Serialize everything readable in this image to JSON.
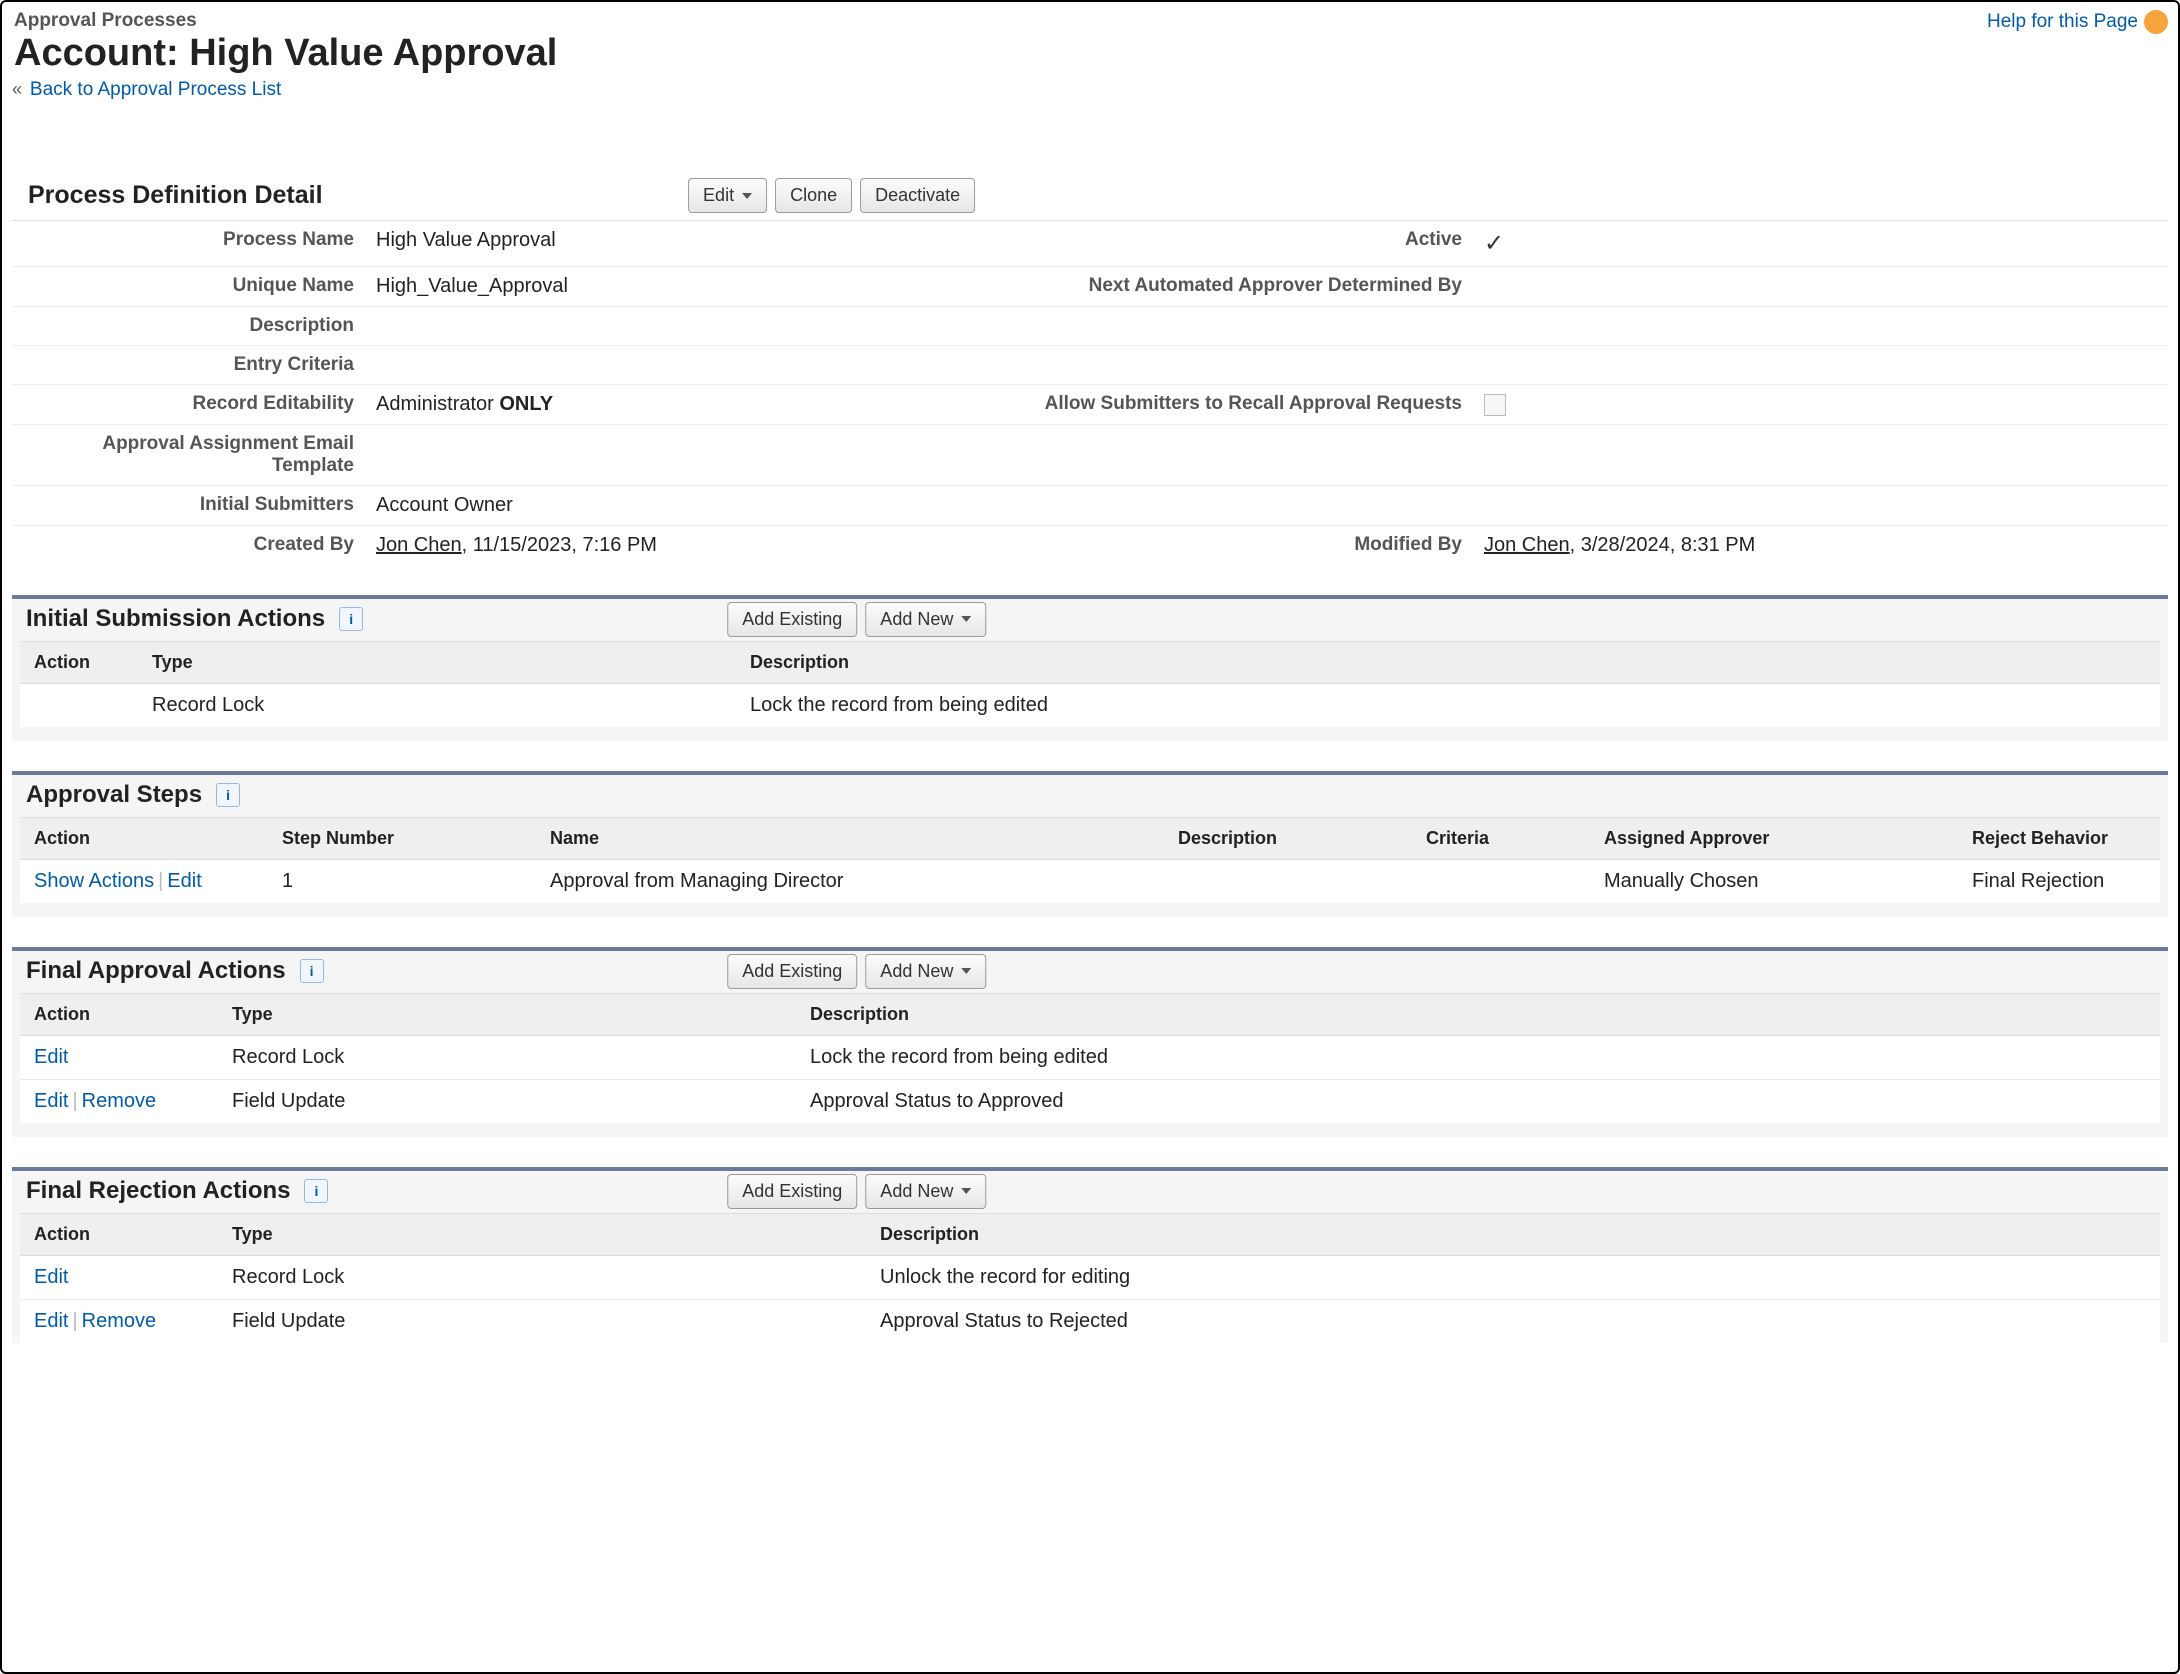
{
  "header": {
    "breadcrumb": "Approval Processes",
    "title": "Account: High Value Approval",
    "back_link": "Back to Approval Process List",
    "help_link": "Help for this Page"
  },
  "definition": {
    "section_title": "Process Definition Detail",
    "buttons": {
      "edit": "Edit",
      "clone": "Clone",
      "deactivate": "Deactivate"
    },
    "labels": {
      "process_name": "Process Name",
      "unique_name": "Unique Name",
      "description": "Description",
      "entry_criteria": "Entry Criteria",
      "record_editability": "Record Editability",
      "approval_assignment_email": "Approval Assignment Email Template",
      "initial_submitters": "Initial Submitters",
      "created_by": "Created By",
      "active": "Active",
      "next_auto": "Next Automated Approver Determined By",
      "allow_recall": "Allow Submitters to Recall Approval Requests",
      "modified_by": "Modified By"
    },
    "values": {
      "process_name": "High Value Approval",
      "unique_name": "High_Value_Approval",
      "description": "",
      "entry_criteria": "",
      "record_editability_prefix": "Administrator ",
      "record_editability_bold": "ONLY",
      "approval_assignment_email": "",
      "initial_submitters": "Account Owner",
      "created_by_name": "Jon Chen",
      "created_by_rest": ", 11/15/2023, 7:16 PM",
      "active": true,
      "next_auto": "",
      "allow_recall": false,
      "modified_by_name": "Jon Chen",
      "modified_by_rest": ", 3/28/2024, 8:31 PM"
    }
  },
  "common": {
    "add_existing": "Add Existing",
    "add_new": "Add New",
    "edit": "Edit",
    "remove": "Remove",
    "show_actions": "Show Actions"
  },
  "initial_submission": {
    "title": "Initial Submission Actions",
    "columns": {
      "action": "Action",
      "type": "Type",
      "description": "Description"
    },
    "rows": [
      {
        "action": "",
        "type": "Record Lock",
        "description": "Lock the record from being edited"
      }
    ]
  },
  "approval_steps": {
    "title": "Approval Steps",
    "columns": {
      "action": "Action",
      "step_number": "Step Number",
      "name": "Name",
      "description": "Description",
      "criteria": "Criteria",
      "assigned": "Assigned Approver",
      "reject": "Reject Behavior"
    },
    "rows": [
      {
        "step_number": "1",
        "name": "Approval from Managing Director",
        "description": "",
        "criteria": "",
        "assigned": "Manually Chosen",
        "reject": "Final Rejection"
      }
    ]
  },
  "final_approval": {
    "title": "Final Approval Actions",
    "columns": {
      "action": "Action",
      "type": "Type",
      "description": "Description"
    },
    "rows": [
      {
        "action_edit": true,
        "action_remove": false,
        "type": "Record Lock",
        "description": "Lock the record from being edited",
        "desc_link": false
      },
      {
        "action_edit": true,
        "action_remove": true,
        "type": "Field Update",
        "description": "Approval Status to Approved",
        "desc_link": true
      }
    ]
  },
  "final_rejection": {
    "title": "Final Rejection Actions",
    "columns": {
      "action": "Action",
      "type": "Type",
      "description": "Description"
    },
    "rows": [
      {
        "action_edit": true,
        "action_remove": false,
        "type": "Record Lock",
        "description": "Unlock the record for editing",
        "desc_link": false
      },
      {
        "action_edit": true,
        "action_remove": true,
        "type": "Field Update",
        "description": "Approval Status to Rejected",
        "desc_link": true
      }
    ]
  }
}
